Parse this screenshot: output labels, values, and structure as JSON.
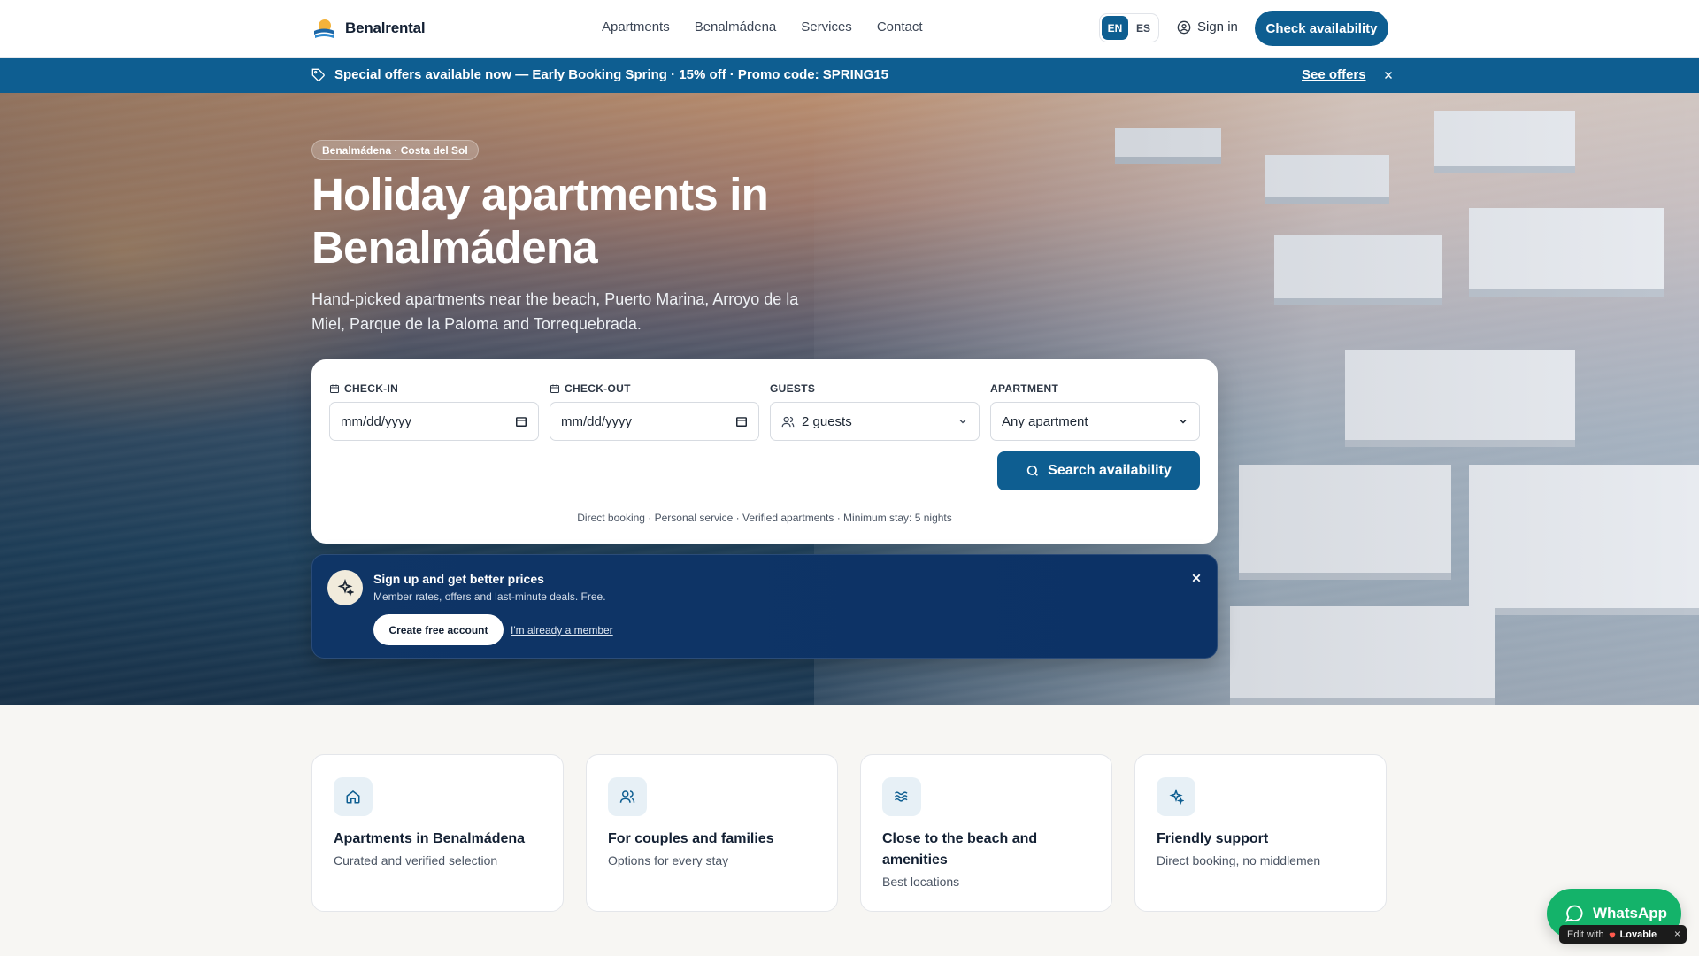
{
  "colors": {
    "primary": "#0e5e91",
    "promo_bg": "#0e5e91",
    "signup_bg": "#0f3566",
    "whatsapp": "#14b36a",
    "page_bg": "#f7f6f3"
  },
  "header": {
    "brand": "Benalrental",
    "nav": [
      "Apartments",
      "Benalmádena",
      "Services",
      "Contact"
    ],
    "languages": [
      {
        "code": "EN",
        "active": true
      },
      {
        "code": "ES",
        "active": false
      }
    ],
    "signin": "Sign in",
    "cta": "Check availability"
  },
  "promo": {
    "text": "Special offers available now — Early Booking Spring · 15% off · Promo code: SPRING15",
    "link": "See offers"
  },
  "hero": {
    "badge": "Benalmádena · Costa del Sol",
    "title": "Holiday apartments in Benalmádena",
    "subtitle": "Hand-picked apartments near the beach, Puerto Marina, Arroyo de la Miel, Parque de la Paloma and Torrequebrada."
  },
  "booking": {
    "checkin": {
      "label": "CHECK-IN",
      "value": "mm/dd/yyyy"
    },
    "checkout": {
      "label": "CHECK-OUT",
      "value": "mm/dd/yyyy"
    },
    "guests": {
      "label": "GUESTS",
      "value": "2 guests"
    },
    "apartment": {
      "label": "APARTMENT",
      "value": "Any apartment"
    },
    "search": "Search availability",
    "note": "Direct booking · Personal service · Verified apartments · Minimum stay: 5 nights"
  },
  "signup": {
    "title": "Sign up and get better prices",
    "subtitle": "Member rates, offers and last-minute deals. Free.",
    "create": "Create free account",
    "member": "I'm already a member"
  },
  "features": [
    {
      "icon": "home-icon",
      "title": "Apartments in Benalmádena",
      "desc": "Curated and verified selection"
    },
    {
      "icon": "users-icon",
      "title": "For couples and families",
      "desc": "Options for every stay"
    },
    {
      "icon": "waves-icon",
      "title": "Close to the beach and amenities",
      "desc": "Best locations"
    },
    {
      "icon": "sparkles-icon",
      "title": "Friendly support",
      "desc": "Direct booking, no middlemen"
    }
  ],
  "whatsapp": {
    "label": "WhatsApp"
  },
  "lovable": {
    "prefix": "Edit with",
    "brand": "Lovable",
    "close": "×"
  }
}
